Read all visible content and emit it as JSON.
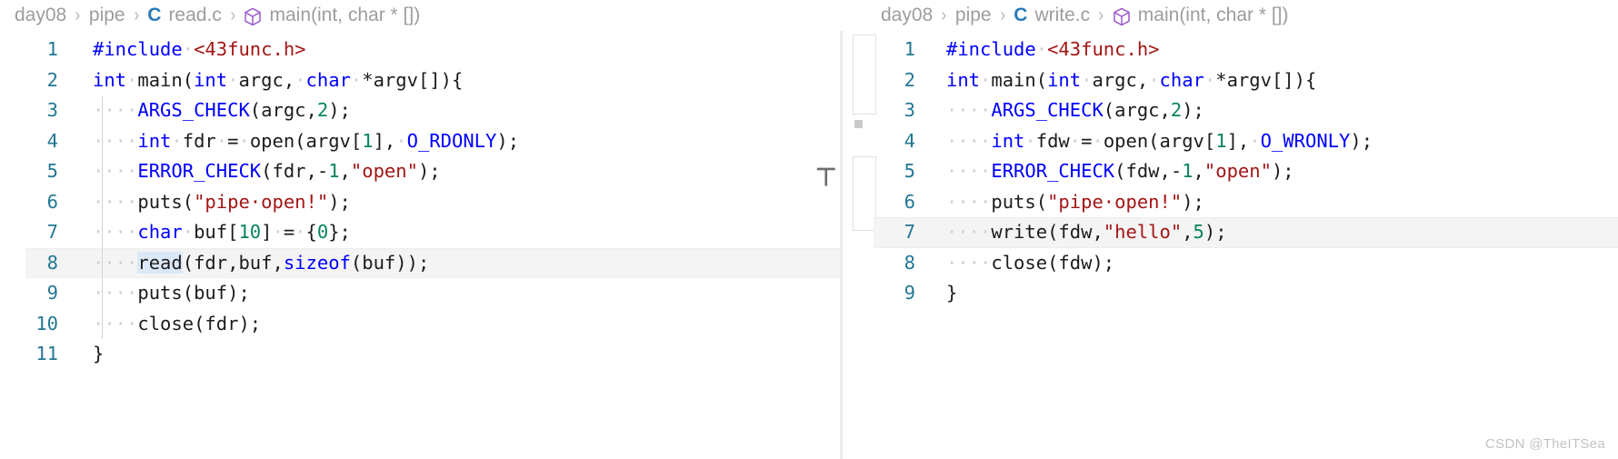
{
  "watermark": "CSDN @TheITSea",
  "left": {
    "breadcrumb": {
      "items": [
        "day08",
        "pipe",
        "read.c",
        "main(int, char * [])"
      ],
      "separator": "›",
      "file_icon_label": "C",
      "symbol_icon": "cube-icon"
    },
    "current_line": 8,
    "selection_word": "read",
    "lines": [
      {
        "num": "1",
        "indent": 0,
        "tokens": [
          {
            "t": "#include",
            "c": "k"
          },
          {
            "t": "·",
            "c": "ws"
          },
          {
            "t": "<43func.h>",
            "c": "s"
          }
        ]
      },
      {
        "num": "2",
        "indent": 0,
        "tokens": [
          {
            "t": "int",
            "c": "k"
          },
          {
            "t": "·",
            "c": "ws"
          },
          {
            "t": "main(",
            "c": "p"
          },
          {
            "t": "int",
            "c": "k"
          },
          {
            "t": "·",
            "c": "ws"
          },
          {
            "t": "argc,",
            "c": "p"
          },
          {
            "t": "·",
            "c": "ws"
          },
          {
            "t": "char",
            "c": "k"
          },
          {
            "t": "·",
            "c": "ws"
          },
          {
            "t": "*argv[]){",
            "c": "p"
          }
        ]
      },
      {
        "num": "3",
        "indent": 1,
        "tokens": [
          {
            "t": "ARGS_CHECK",
            "c": "k"
          },
          {
            "t": "(argc,",
            "c": "p"
          },
          {
            "t": "2",
            "c": "n"
          },
          {
            "t": ");",
            "c": "p"
          }
        ]
      },
      {
        "num": "4",
        "indent": 1,
        "tokens": [
          {
            "t": "int",
            "c": "k"
          },
          {
            "t": "·",
            "c": "ws"
          },
          {
            "t": "fdr",
            "c": "p"
          },
          {
            "t": "·",
            "c": "ws"
          },
          {
            "t": "=",
            "c": "p"
          },
          {
            "t": "·",
            "c": "ws"
          },
          {
            "t": "open(argv[",
            "c": "p"
          },
          {
            "t": "1",
            "c": "n"
          },
          {
            "t": "],",
            "c": "p"
          },
          {
            "t": "·",
            "c": "ws"
          },
          {
            "t": "O_RDONLY",
            "c": "k"
          },
          {
            "t": ");",
            "c": "p"
          }
        ]
      },
      {
        "num": "5",
        "indent": 1,
        "tokens": [
          {
            "t": "ERROR_CHECK",
            "c": "k"
          },
          {
            "t": "(fdr,-",
            "c": "p"
          },
          {
            "t": "1",
            "c": "n"
          },
          {
            "t": ",",
            "c": "p"
          },
          {
            "t": "\"open\"",
            "c": "s"
          },
          {
            "t": ");",
            "c": "p"
          }
        ]
      },
      {
        "num": "6",
        "indent": 1,
        "tokens": [
          {
            "t": "puts(",
            "c": "p"
          },
          {
            "t": "\"pipe·open!\"",
            "c": "s"
          },
          {
            "t": ");",
            "c": "p"
          }
        ]
      },
      {
        "num": "7",
        "indent": 1,
        "tokens": [
          {
            "t": "char",
            "c": "k"
          },
          {
            "t": "·",
            "c": "ws"
          },
          {
            "t": "buf[",
            "c": "p"
          },
          {
            "t": "10",
            "c": "n"
          },
          {
            "t": "]",
            "c": "p"
          },
          {
            "t": "·",
            "c": "ws"
          },
          {
            "t": "=",
            "c": "p"
          },
          {
            "t": "·",
            "c": "ws"
          },
          {
            "t": "{",
            "c": "p"
          },
          {
            "t": "0",
            "c": "n"
          },
          {
            "t": "};",
            "c": "p"
          }
        ]
      },
      {
        "num": "8",
        "indent": 1,
        "tokens": [
          {
            "t": "read",
            "c": "p sel"
          },
          {
            "t": "(fdr,buf,",
            "c": "p"
          },
          {
            "t": "sizeof",
            "c": "k"
          },
          {
            "t": "(buf));",
            "c": "p"
          }
        ]
      },
      {
        "num": "9",
        "indent": 1,
        "tokens": [
          {
            "t": "puts(buf);",
            "c": "p"
          }
        ]
      },
      {
        "num": "10",
        "indent": 1,
        "tokens": [
          {
            "t": "close(fdr);",
            "c": "p"
          }
        ]
      },
      {
        "num": "11",
        "indent": 0,
        "tokens": [
          {
            "t": "}",
            "c": "p"
          }
        ]
      }
    ]
  },
  "right": {
    "breadcrumb": {
      "items": [
        "day08",
        "pipe",
        "write.c",
        "main(int, char * [])"
      ],
      "separator": "›",
      "file_icon_label": "C",
      "symbol_icon": "cube-icon"
    },
    "current_line": 7,
    "lines": [
      {
        "num": "1",
        "indent": 0,
        "tokens": [
          {
            "t": "#include",
            "c": "k"
          },
          {
            "t": "·",
            "c": "ws"
          },
          {
            "t": "<43func.h>",
            "c": "s"
          }
        ]
      },
      {
        "num": "2",
        "indent": 0,
        "tokens": [
          {
            "t": "int",
            "c": "k"
          },
          {
            "t": "·",
            "c": "ws"
          },
          {
            "t": "main(",
            "c": "p"
          },
          {
            "t": "int",
            "c": "k"
          },
          {
            "t": "·",
            "c": "ws"
          },
          {
            "t": "argc,",
            "c": "p"
          },
          {
            "t": "·",
            "c": "ws"
          },
          {
            "t": "char",
            "c": "k"
          },
          {
            "t": "·",
            "c": "ws"
          },
          {
            "t": "*argv[]){",
            "c": "p"
          }
        ]
      },
      {
        "num": "3",
        "indent": 1,
        "tokens": [
          {
            "t": "ARGS_CHECK",
            "c": "k"
          },
          {
            "t": "(argc,",
            "c": "p"
          },
          {
            "t": "2",
            "c": "n"
          },
          {
            "t": ");",
            "c": "p"
          }
        ]
      },
      {
        "num": "4",
        "indent": 1,
        "tokens": [
          {
            "t": "int",
            "c": "k"
          },
          {
            "t": "·",
            "c": "ws"
          },
          {
            "t": "fdw",
            "c": "p"
          },
          {
            "t": "·",
            "c": "ws"
          },
          {
            "t": "=",
            "c": "p"
          },
          {
            "t": "·",
            "c": "ws"
          },
          {
            "t": "open(argv[",
            "c": "p"
          },
          {
            "t": "1",
            "c": "n"
          },
          {
            "t": "],",
            "c": "p"
          },
          {
            "t": "·",
            "c": "ws"
          },
          {
            "t": "O_WRONLY",
            "c": "k"
          },
          {
            "t": ");",
            "c": "p"
          }
        ]
      },
      {
        "num": "5",
        "indent": 1,
        "tokens": [
          {
            "t": "ERROR_CHECK",
            "c": "k"
          },
          {
            "t": "(fdw,-",
            "c": "p"
          },
          {
            "t": "1",
            "c": "n"
          },
          {
            "t": ",",
            "c": "p"
          },
          {
            "t": "\"open\"",
            "c": "s"
          },
          {
            "t": ");",
            "c": "p"
          }
        ]
      },
      {
        "num": "6",
        "indent": 1,
        "tokens": [
          {
            "t": "puts(",
            "c": "p"
          },
          {
            "t": "\"pipe·open!\"",
            "c": "s"
          },
          {
            "t": ");",
            "c": "p"
          }
        ]
      },
      {
        "num": "7",
        "indent": 1,
        "tokens": [
          {
            "t": "write(fdw,",
            "c": "p"
          },
          {
            "t": "\"hello\"",
            "c": "s"
          },
          {
            "t": ",",
            "c": "p"
          },
          {
            "t": "5",
            "c": "n"
          },
          {
            "t": ");",
            "c": "p"
          }
        ]
      },
      {
        "num": "8",
        "indent": 1,
        "tokens": [
          {
            "t": "close(fdw);",
            "c": "p"
          }
        ]
      },
      {
        "num": "9",
        "indent": 0,
        "tokens": [
          {
            "t": "}",
            "c": "p"
          }
        ]
      }
    ]
  }
}
